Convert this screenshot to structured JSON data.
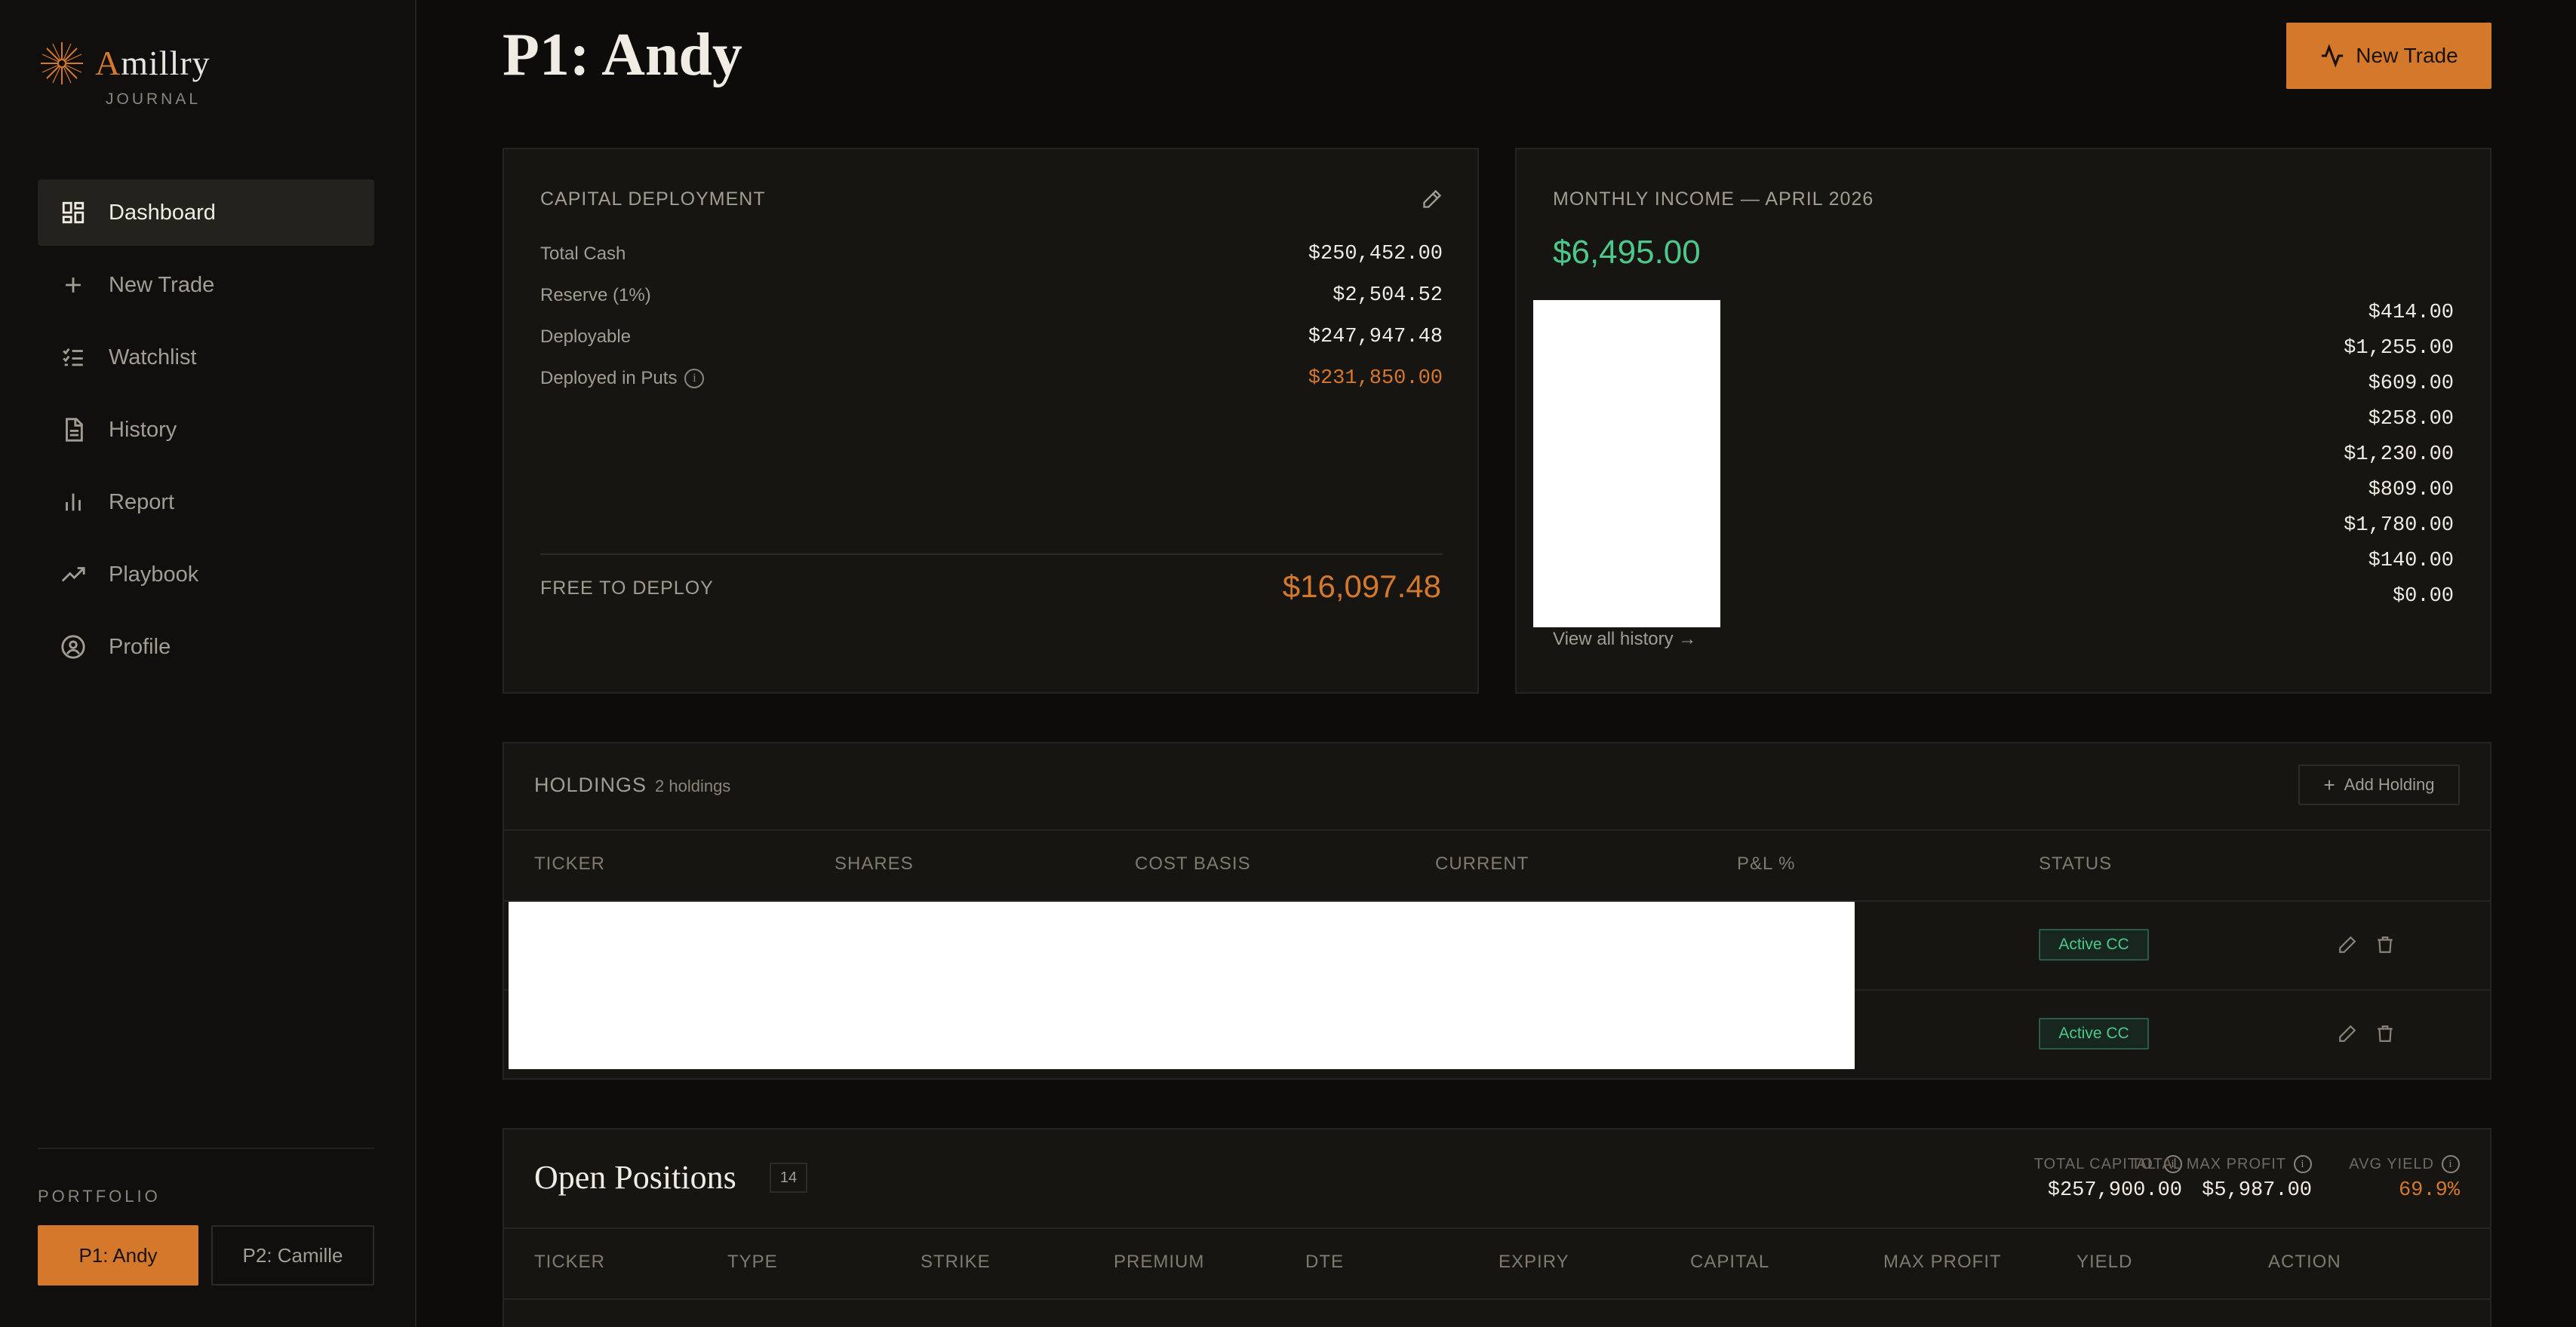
{
  "brand": {
    "name_initial": "A",
    "name_rest": "millry",
    "subtitle": "JOURNAL"
  },
  "sidebar": {
    "items": [
      {
        "label": "Dashboard",
        "icon": "grid-icon",
        "active": true
      },
      {
        "label": "New Trade",
        "icon": "plus-icon"
      },
      {
        "label": "Watchlist",
        "icon": "checklist-icon"
      },
      {
        "label": "History",
        "icon": "document-icon"
      },
      {
        "label": "Report",
        "icon": "bar-chart-icon"
      },
      {
        "label": "Playbook",
        "icon": "trend-up-icon"
      },
      {
        "label": "Profile",
        "icon": "user-circle-icon"
      }
    ],
    "portfolio_label": "PORTFOLIO",
    "portfolios": [
      "P1: Andy",
      "P2: Camille"
    ]
  },
  "header": {
    "title": "P1: Andy",
    "new_trade_label": "New Trade"
  },
  "capital": {
    "title": "CAPITAL DEPLOYMENT",
    "rows": [
      {
        "label": "Total Cash",
        "value": "$250,452.00"
      },
      {
        "label": "Reserve (1%)",
        "value": "$2,504.52"
      },
      {
        "label": "Deployable",
        "value": "$247,947.48"
      },
      {
        "label": "Deployed in Puts",
        "value": "$231,850.00"
      }
    ],
    "free_label": "FREE TO DEPLOY",
    "free_value": "$16,097.48"
  },
  "income": {
    "title": "MONTHLY INCOME — APRIL 2026",
    "total": "$6,495.00",
    "values": [
      "$414.00",
      "$1,255.00",
      "$609.00",
      "$258.00",
      "$1,230.00",
      "$809.00",
      "$1,780.00",
      "$140.00",
      "$0.00"
    ],
    "view_all": "View all history →"
  },
  "holdings": {
    "title": "HOLDINGS",
    "count": "2 holdings",
    "add_label": "Add Holding",
    "columns": [
      "TICKER",
      "SHARES",
      "COST BASIS",
      "CURRENT",
      "P&L %",
      "STATUS"
    ],
    "rows": [
      {
        "status": "Active CC"
      },
      {
        "status": "Active CC"
      }
    ]
  },
  "positions": {
    "title": "Open Positions",
    "count": "14",
    "stats": [
      {
        "label": "TOTAL CAPITAL",
        "value": "$257,900.00"
      },
      {
        "label": "TOTAL MAX PROFIT",
        "value": "$5,987.00"
      },
      {
        "label": "AVG YIELD",
        "value": "69.9%"
      }
    ],
    "columns": [
      "TICKER",
      "TYPE",
      "STRIKE",
      "PREMIUM",
      "DTE",
      "EXPIRY",
      "CAPITAL",
      "MAX PROFIT",
      "YIELD",
      "ACTION"
    ]
  },
  "colors": {
    "accent": "#d4782c",
    "positive": "#4cc98a",
    "background": "#0d0c0a",
    "card": "#171511"
  }
}
